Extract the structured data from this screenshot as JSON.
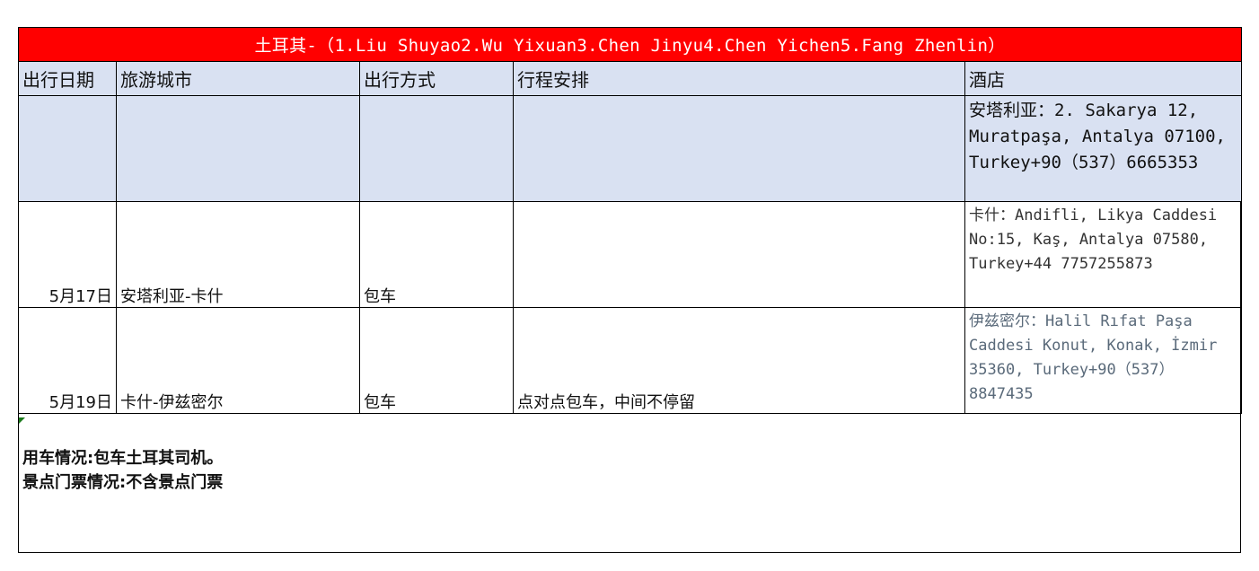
{
  "title": "土耳其-（1.Liu Shuyao2.Wu Yixuan3.Chen Jinyu4.Chen Yichen5.Fang Zhenlin）",
  "headers": {
    "date": "出行日期",
    "city": "旅游城市",
    "transport": "出行方式",
    "schedule": "行程安排",
    "hotel": "酒店"
  },
  "rows": [
    {
      "date": "",
      "city": "",
      "transport": "",
      "schedule": "",
      "hotel": "安塔利亚：2. Sakarya 12, Muratpaşa, Antalya 07100, Turkey+90（537）6665353"
    },
    {
      "date": "5月17日",
      "city": "安塔利亚-卡什",
      "transport": "包车",
      "schedule": "",
      "hotel": "卡什：Andifli, Likya Caddesi No:15, Kaş, Antalya 07580, Turkey+44 7757255873"
    },
    {
      "date": "5月19日",
      "city": "卡什-伊兹密尔",
      "transport": "包车",
      "schedule": "点对点包车，中间不停留",
      "hotel": "伊兹密尔：Halil Rıfat Paşa Caddesi Konut, Konak, İzmir 35360, Turkey+90（537）8847435"
    }
  ],
  "notes": {
    "vehicle": "用车情况:包车土耳其司机。",
    "tickets": "景点门票情况:不含景点门票"
  },
  "colors": {
    "title_bg": "#ff0000",
    "header_bg": "#d9e1f2",
    "marker": "#1b7a1b"
  }
}
